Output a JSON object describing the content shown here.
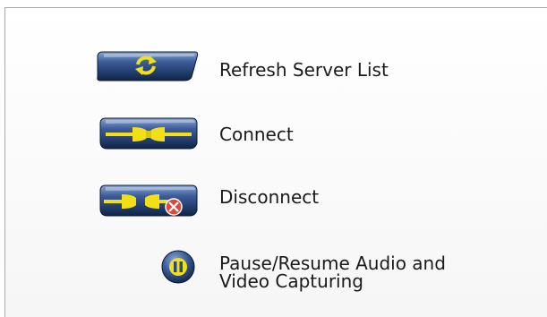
{
  "legend": {
    "items": [
      {
        "icon": "refresh-icon",
        "label": "Refresh Server List"
      },
      {
        "icon": "plug-connected-icon",
        "label": "Connect"
      },
      {
        "icon": "plug-disconnected-icon",
        "label": "Disconnect"
      },
      {
        "icon": "pause-icon",
        "label_line1": "Pause/Resume Audio and",
        "label_line2": "Video Capturing"
      }
    ]
  },
  "colors": {
    "button_dark": "#0f2447",
    "button_mid": "#2b4a85",
    "button_light": "#6f8fc7",
    "icon_yellow": "#f2df17",
    "icon_red": "#e0483a"
  }
}
